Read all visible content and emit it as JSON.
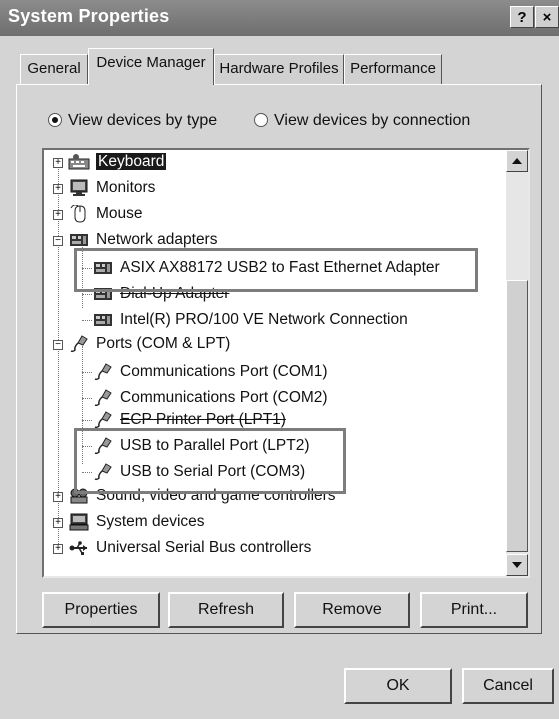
{
  "window": {
    "title": "System Properties",
    "help_label": "?",
    "close_label": "×"
  },
  "tabs": [
    {
      "label": "General"
    },
    {
      "label": "Device Manager",
      "active": true
    },
    {
      "label": "Hardware Profiles"
    },
    {
      "label": "Performance"
    }
  ],
  "view_options": {
    "by_type": {
      "label": "View devices by type",
      "checked": true
    },
    "by_connection": {
      "label": "View devices by connection",
      "checked": false
    }
  },
  "tree": {
    "items": [
      {
        "label": "Keyboard",
        "selected": true
      },
      {
        "label": "Monitors"
      },
      {
        "label": "Mouse"
      },
      {
        "label": "Network adapters"
      },
      {
        "label": "ASIX AX88172 USB2 to Fast Ethernet Adapter"
      },
      {
        "label": "Dial-Up Adapter"
      },
      {
        "label": "Intel(R) PRO/100 VE Network Connection"
      },
      {
        "label": "Ports (COM & LPT)"
      },
      {
        "label": "Communications Port (COM1)"
      },
      {
        "label": "Communications Port (COM2)"
      },
      {
        "label": "ECP Printer Port (LPT1)"
      },
      {
        "label": "USB to Parallel Port (LPT2)"
      },
      {
        "label": "USB to Serial Port (COM3)"
      },
      {
        "label": "Sound, video and game controllers"
      },
      {
        "label": "System devices"
      },
      {
        "label": "Universal Serial Bus controllers"
      }
    ]
  },
  "actions": {
    "properties": "Properties",
    "refresh": "Refresh",
    "remove": "Remove",
    "print": "Print..."
  },
  "footer": {
    "ok": "OK",
    "cancel": "Cancel"
  }
}
